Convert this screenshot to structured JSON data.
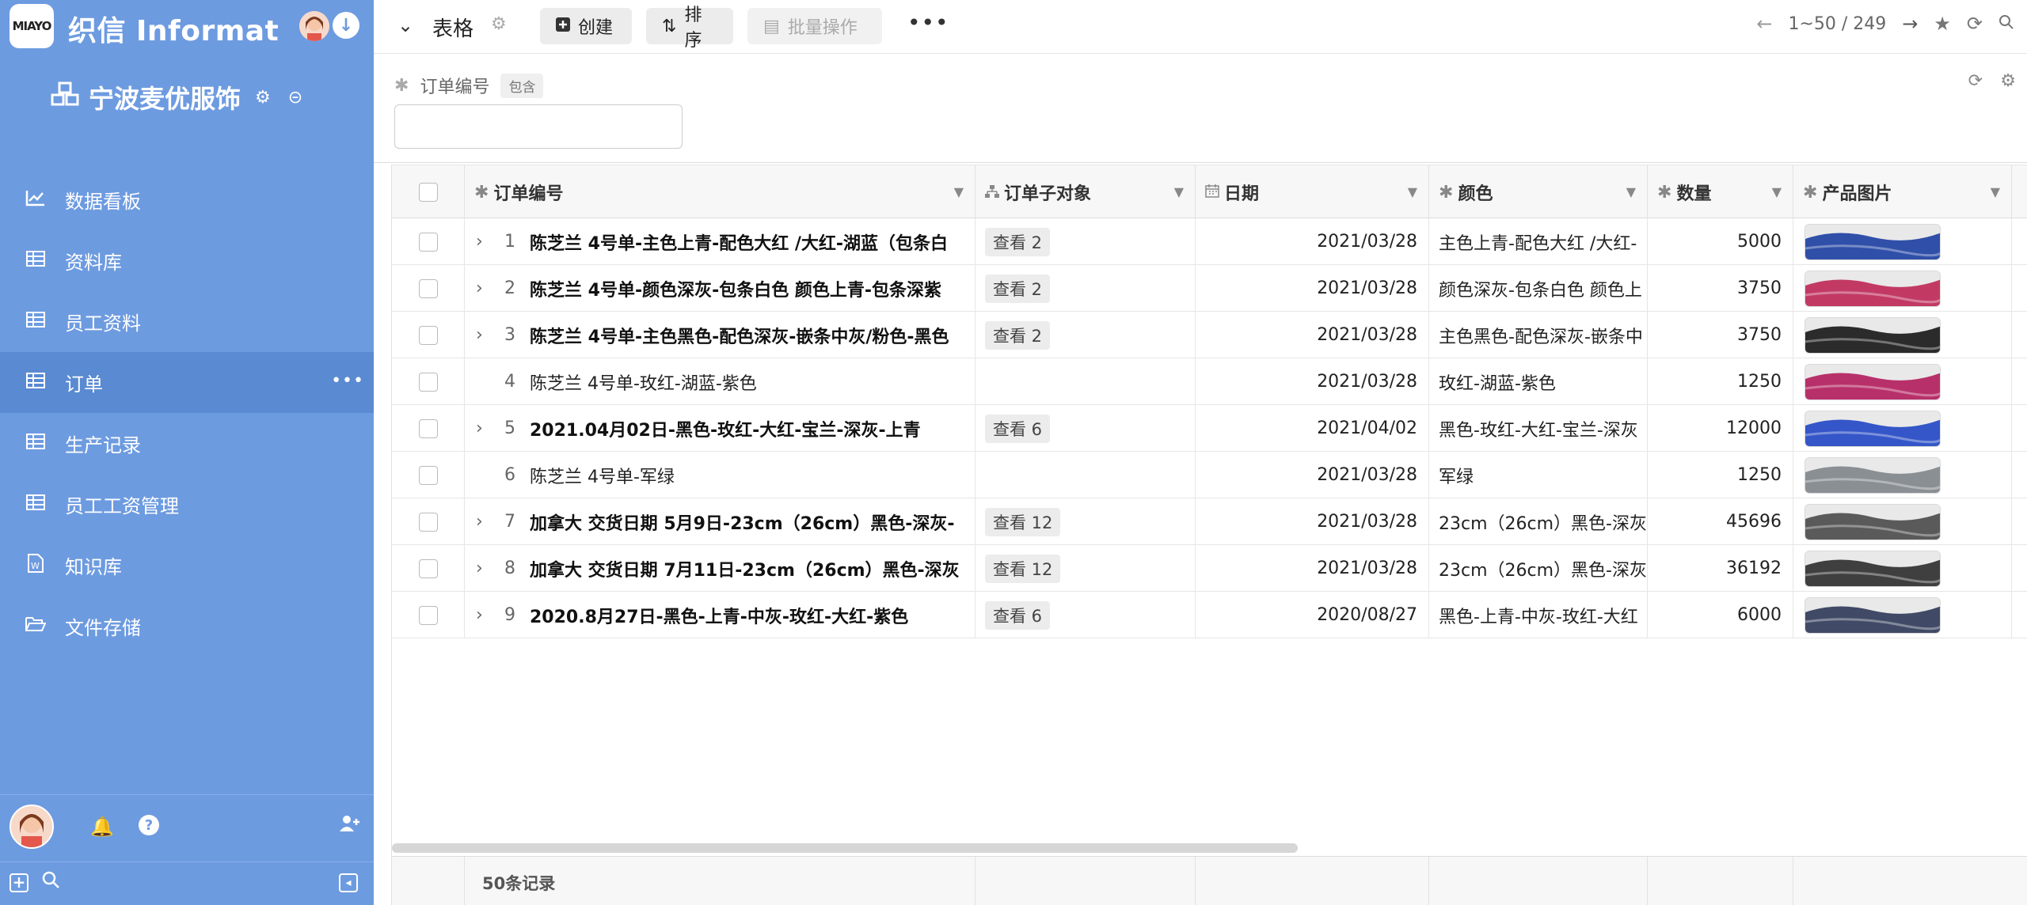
{
  "app": {
    "logo_text": "MIAYO",
    "name": "织信 Informat"
  },
  "workspace": {
    "name": "宁波麦优服饰"
  },
  "sidebar": {
    "items": [
      {
        "label": "数据看板",
        "icon": "chart-line-icon"
      },
      {
        "label": "资料库",
        "icon": "table-icon"
      },
      {
        "label": "员工资料",
        "icon": "table-icon"
      },
      {
        "label": "订单",
        "icon": "table-icon",
        "active": true
      },
      {
        "label": "生产记录",
        "icon": "table-icon"
      },
      {
        "label": "员工工资管理",
        "icon": "table-icon"
      },
      {
        "label": "知识库",
        "icon": "word-doc-icon"
      },
      {
        "label": "文件存储",
        "icon": "folder-open-icon"
      }
    ]
  },
  "toolbar": {
    "title": "表格",
    "create_label": "创建",
    "sort_label": "排序",
    "batch_label": "批量操作",
    "pager": "1~50 / 249"
  },
  "filter": {
    "field": "订单编号",
    "operator": "包含",
    "value": ""
  },
  "columns": [
    {
      "label": "订单编号",
      "icon": "asterisk-icon"
    },
    {
      "label": "订单子对象",
      "icon": "sitemap-icon"
    },
    {
      "label": "日期",
      "icon": "calendar-icon"
    },
    {
      "label": "颜色",
      "icon": "asterisk-icon"
    },
    {
      "label": "数量",
      "icon": "asterisk-icon"
    },
    {
      "label": "产品图片",
      "icon": "asterisk-icon"
    }
  ],
  "rows": [
    {
      "idx": "1",
      "expandable": true,
      "title": "陈芝兰 4号单-主色上青-配色大红 /大红-湖蓝（包条白",
      "sub": "查看 2",
      "date": "2021/03/28",
      "color": "主色上青-配色大红 /大红-",
      "qty": "5000",
      "img": "#2f4fa8"
    },
    {
      "idx": "2",
      "expandable": true,
      "title": "陈芝兰 4号单-颜色深灰-包条白色 颜色上青-包条深紫",
      "sub": "查看 2",
      "date": "2021/03/28",
      "color": "颜色深灰-包条白色 颜色上",
      "qty": "3750",
      "img": "#c23a64"
    },
    {
      "idx": "3",
      "expandable": true,
      "title": "陈芝兰 4号单-主色黑色-配色深灰-嵌条中灰/粉色-黑色",
      "sub": "查看 2",
      "date": "2021/03/28",
      "color": "主色黑色-配色深灰-嵌条中",
      "qty": "3750",
      "img": "#2b2b2b"
    },
    {
      "idx": "4",
      "expandable": false,
      "title": "陈芝兰 4号单-玫红-湖蓝-紫色",
      "sub": "",
      "date": "2021/03/28",
      "color": "玫红-湖蓝-紫色",
      "qty": "1250",
      "img": "#b8306a"
    },
    {
      "idx": "5",
      "expandable": true,
      "title": "2021.04月02日-黑色-玫红-大红-宝兰-深灰-上青",
      "sub": "查看 6",
      "date": "2021/04/02",
      "color": "黑色-玫红-大红-宝兰-深灰",
      "qty": "12000",
      "img": "#3456c8"
    },
    {
      "idx": "6",
      "expandable": false,
      "title": "陈芝兰 4号单-军绿",
      "sub": "",
      "date": "2021/03/28",
      "color": "军绿",
      "qty": "1250",
      "img": "#8a8f94"
    },
    {
      "idx": "7",
      "expandable": true,
      "title": "加拿大 交货日期 5月9日-23cm（26cm）黑色-深灰-",
      "sub": "查看 12",
      "date": "2021/03/28",
      "color": "23cm（26cm）黑色-深灰",
      "qty": "45696",
      "img": "#5a5a5a"
    },
    {
      "idx": "8",
      "expandable": true,
      "title": "加拿大 交货日期 7月11日-23cm（26cm）黑色-深灰",
      "sub": "查看 12",
      "date": "2021/03/28",
      "color": "23cm（26cm）黑色-深灰",
      "qty": "36192",
      "img": "#3f3f3f"
    },
    {
      "idx": "9",
      "expandable": true,
      "title": "2020.8月27日-黑色-上青-中灰-玫红-大红-紫色",
      "sub": "查看 6",
      "date": "2020/08/27",
      "color": "黑色-上青-中灰-玫红-大红",
      "qty": "6000",
      "img": "#404a66"
    }
  ],
  "footer": {
    "count": "50条记录"
  }
}
